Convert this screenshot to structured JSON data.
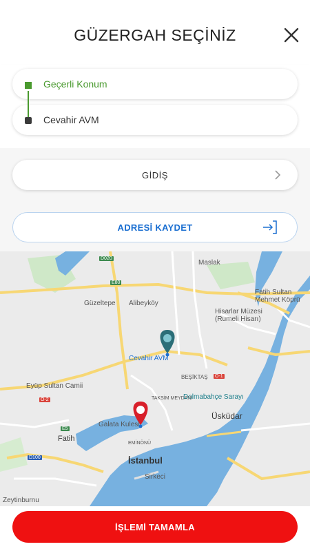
{
  "header": {
    "title": "GÜZERGAH SEÇİNİZ"
  },
  "route": {
    "from_label": "Geçerli Konum",
    "to_label": "Cevahir AVM"
  },
  "direction": {
    "label": "GİDİŞ"
  },
  "save": {
    "label": "ADRESİ KAYDET"
  },
  "map": {
    "labels": {
      "maslak": "Maslak",
      "fatih_sultan_mehmet_koprusu": "Fatih Sultan\nMehmet Köprü",
      "rumeli_hisari": "Hisarlar Müzesi\n(Rumeli Hisarı)",
      "guzeltepe": "Güzeltepe",
      "alibeykoy": "Alibeyköy",
      "cevahir_avm": "Cevahir AVM",
      "eyup_sultan": "Eyüp Sultan Camii",
      "besiktas": "BEŞİKTAŞ",
      "taksim": "TAKSİM MEYDANI",
      "dolmabahce": "Dolmabahçe Sarayı",
      "galata_kulesi": "Galata Kulesi",
      "uskudar": "Üsküdar",
      "fatih": "Fatih",
      "eminonu": "EMİNÖNÜ",
      "istanbul": "İstanbul",
      "sirkeci": "Sirkeci",
      "zeytinburnu": "Zeytinburnu"
    },
    "roads": {
      "e80": "E80",
      "d020": "D020",
      "o1": "O-1",
      "e5": "E5",
      "d100": "D100",
      "o2": "O-2"
    }
  },
  "footer": {
    "complete_label": "İŞLEMİ TAMAMLA"
  },
  "colors": {
    "accent_red": "#ef1111",
    "accent_green": "#4a9a2f",
    "accent_blue": "#1b6fd1",
    "pin_teal": "#2b6e78"
  }
}
